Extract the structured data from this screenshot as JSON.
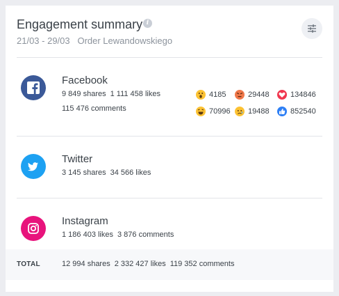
{
  "header": {
    "title": "Engagement summary",
    "subtitle_dates": "21/03 - 29/03",
    "subtitle_account": "Order Lewandowskiego"
  },
  "platforms": [
    {
      "name": "Facebook",
      "color": "#3b5998",
      "icon": "facebook-icon",
      "shares": "9 849 shares",
      "likes": "1 111 458 likes",
      "comments": "115 476 comments",
      "reactions": [
        {
          "name": "wow-reaction-icon",
          "count": "4185"
        },
        {
          "name": "angry-reaction-icon",
          "count": "29448"
        },
        {
          "name": "love-reaction-icon",
          "count": "134846"
        },
        {
          "name": "haha-reaction-icon",
          "count": "70996"
        },
        {
          "name": "sad-reaction-icon",
          "count": "19488"
        },
        {
          "name": "like-reaction-icon",
          "count": "852540"
        }
      ]
    },
    {
      "name": "Twitter",
      "color": "#1da1f2",
      "icon": "twitter-icon",
      "shares": "3 145 shares",
      "likes": "34 566 likes"
    },
    {
      "name": "Instagram",
      "color": "#e8137c",
      "icon": "instagram-icon",
      "likes": "1 186 403 likes",
      "comments": "3 876 comments"
    }
  ],
  "total": {
    "label": "TOTAL",
    "shares": "12 994 shares",
    "likes": "2 332 427 likes",
    "comments": "119 352 comments"
  }
}
